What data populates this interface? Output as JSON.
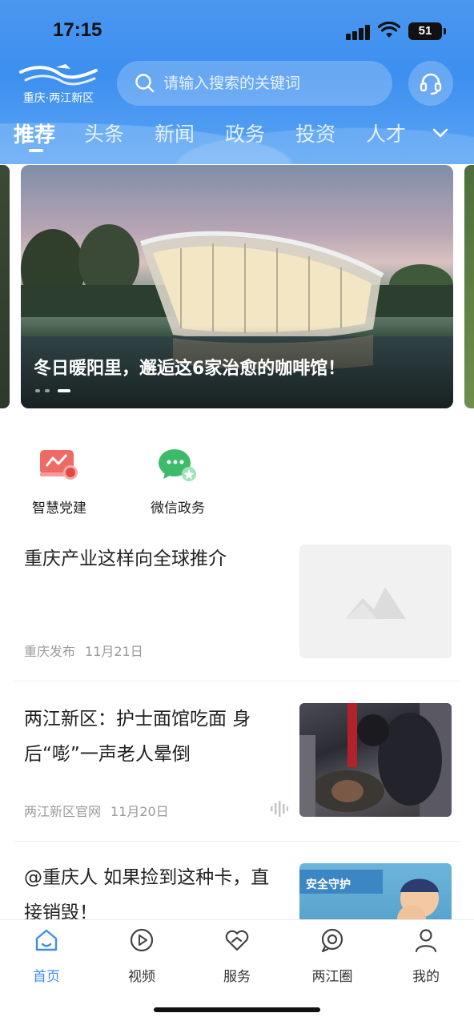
{
  "status_bar": {
    "time": "17:15",
    "battery": "51"
  },
  "header": {
    "logo_text": "重庆·两江新区",
    "search_placeholder": "请输入搜索的关键词"
  },
  "tabs": [
    {
      "label": "推荐",
      "active": true
    },
    {
      "label": "头条"
    },
    {
      "label": "新闻"
    },
    {
      "label": "政务"
    },
    {
      "label": "投资"
    },
    {
      "label": "人才"
    }
  ],
  "banner": {
    "caption": "冬日暖阳里，邂逅这6家治愈的咖啡馆！",
    "slide_count": 3,
    "active_slide": 3
  },
  "shortcuts": [
    {
      "label": "智慧党建",
      "icon": "party-building-icon",
      "color": "#e9524f"
    },
    {
      "label": "微信政务",
      "icon": "wechat-icon",
      "color": "#3dbb6a"
    }
  ],
  "news": [
    {
      "title": "重庆产业这样向全球推介",
      "source": "重庆发布",
      "date": "11月21日",
      "thumb": "placeholder-image-icon"
    },
    {
      "title": "两江新区：护士面馆吃面 身后“嘭”一声老人晕倒",
      "source": "两江新区官网",
      "date": "11月20日",
      "thumb": "photo",
      "audio": true
    },
    {
      "title": "@重庆人 如果捡到这种卡，直接销毁！",
      "thumb": "photo",
      "thumb_text": "安全守护"
    }
  ],
  "bottom_nav": [
    {
      "label": "首页",
      "icon": "home-icon",
      "active": true
    },
    {
      "label": "视频",
      "icon": "video-icon"
    },
    {
      "label": "服务",
      "icon": "service-icon"
    },
    {
      "label": "两江圈",
      "icon": "circle-icon"
    },
    {
      "label": "我的",
      "icon": "profile-icon"
    }
  ],
  "colors": {
    "accent": "#3e8cf0",
    "header": "#4a97ef"
  }
}
